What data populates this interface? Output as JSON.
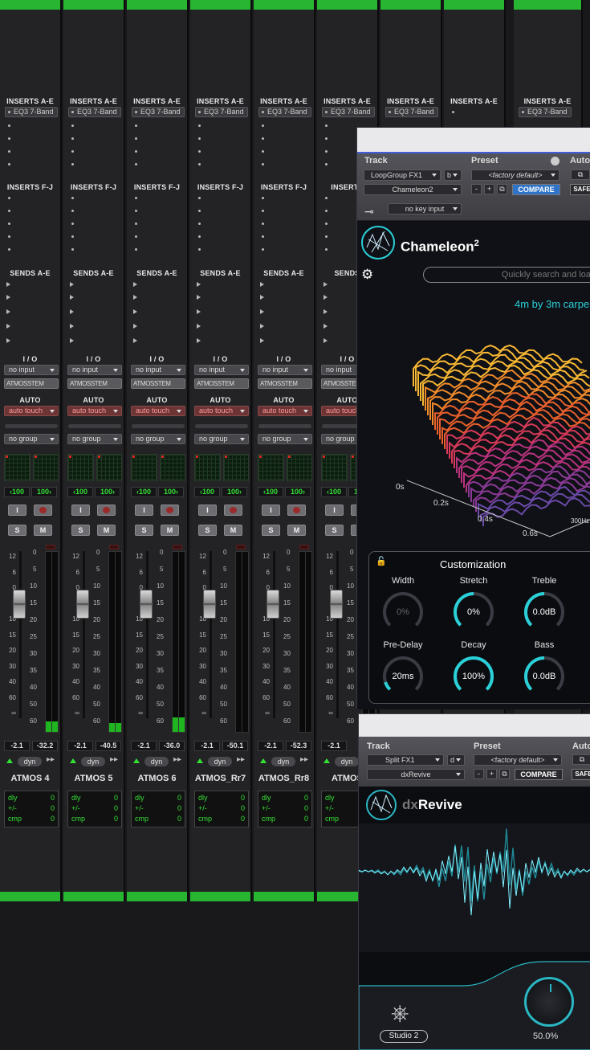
{
  "tracks": [
    {
      "name": "ATMOS 4",
      "volume": "-2.1",
      "peak": "-32.2",
      "insert": "EQ3 7-Band",
      "meter": [
        0.06,
        0.06
      ]
    },
    {
      "name": "ATMOS 5",
      "volume": "-2.1",
      "peak": "-40.5",
      "insert": "EQ3 7-Band",
      "meter": [
        0.05,
        0.05
      ]
    },
    {
      "name": "ATMOS 6",
      "volume": "-2.1",
      "peak": "-36.0",
      "insert": "EQ3 7-Band",
      "meter": [
        0.08,
        0.08
      ]
    },
    {
      "name": "ATMOS_Rr7",
      "volume": "-2.1",
      "peak": "-50.1",
      "insert": "EQ3 7-Band",
      "meter": [
        0.0,
        0.0
      ]
    },
    {
      "name": "ATMOS_Rr8",
      "volume": "-2.1",
      "peak": "-52.3",
      "insert": "EQ3 7-Band",
      "meter": [
        0.0,
        0.0
      ]
    },
    {
      "name": "ATMOS",
      "volume": "-2.1",
      "peak": "",
      "insert": "EQ3 7-Band",
      "meter": [
        0.0,
        0.0
      ]
    },
    {
      "name": "",
      "volume": "",
      "peak": "",
      "insert": "EQ3 7-Band",
      "meter": [
        0,
        0
      ]
    },
    {
      "name": "",
      "volume": "",
      "peak": "",
      "insert": "",
      "meter": [
        0,
        0
      ]
    },
    {
      "name": "",
      "volume": "",
      "peak": "",
      "insert": "EQ3 7-Band",
      "meter": [
        0,
        0
      ]
    }
  ],
  "labels": {
    "inserts_ae": "INSERTS A-E",
    "inserts_fj": "INSERTS F-J",
    "sends_ae": "SENDS A-E",
    "io": "I / O",
    "input": "no input",
    "output": "ATMOSSTEM",
    "auto": "AUTO",
    "auto_mode": "auto touch",
    "group": "no group",
    "pan_left": "‹100",
    "pan_right": "100›",
    "input_btn": "I",
    "solo": "S",
    "mute": "M",
    "dyn": "dyn",
    "comment_dly": "dly",
    "comment_pm": "+/-",
    "comment_cmp": "cmp",
    "comment_val": "0",
    "sends_short": "SENDS",
    "inserts_fj_short": "INSERTS"
  },
  "fader_scale": [
    "12",
    "6",
    "0",
    "5",
    "10",
    "15",
    "20",
    "30",
    "40",
    "60",
    "∞"
  ],
  "meter_scale": [
    "0",
    "5",
    "10",
    "15",
    "20",
    "25",
    "30",
    "35",
    "40",
    "50",
    "60"
  ],
  "chameleon": {
    "track_label": "Track",
    "preset_label": "Preset",
    "auto_label": "Auto",
    "track_name": "LoopGroup FX1",
    "track_variant": "b",
    "plugin_select": "Chameleon2",
    "preset_name": "<factory default>",
    "compare": "COMPARE",
    "safe": "SAFE",
    "key_input": "no key input",
    "minus": "-",
    "plus": "+",
    "brand": "Chameleon",
    "brand_sup": "2",
    "search_placeholder": "Quickly search and loa",
    "preset_title": "4m by 3m carpe",
    "axis": [
      "0s",
      "0.2s",
      "0.4s",
      "0.6s",
      "300Hz"
    ],
    "customization": "Customization",
    "knobs": [
      {
        "label": "Width",
        "value": "0%",
        "level": 0.0
      },
      {
        "label": "Stretch",
        "value": "0%",
        "level": 0.5
      },
      {
        "label": "Treble",
        "value": "0.0dB",
        "level": 0.5
      },
      {
        "label": "Pre-Delay",
        "value": "20ms",
        "level": 0.1
      },
      {
        "label": "Decay",
        "value": "100%",
        "level": 1.0
      },
      {
        "label": "Bass",
        "value": "0.0dB",
        "level": 0.5
      }
    ],
    "accent": "#2ad0d8"
  },
  "dxrevive": {
    "track_label": "Track",
    "preset_label": "Preset",
    "auto_label": "Auto",
    "track_name": "Split FX1",
    "track_variant": "d",
    "plugin_select": "dxRevive",
    "preset_name": "<factory default>",
    "compare": "COMPARE",
    "safe": "SAFE",
    "minus": "-",
    "plus": "+",
    "brand_dx": "dx",
    "brand_rest": "Revive",
    "model": "Studio 2",
    "amount": "50.0%",
    "accent": "#2ab7c4"
  }
}
